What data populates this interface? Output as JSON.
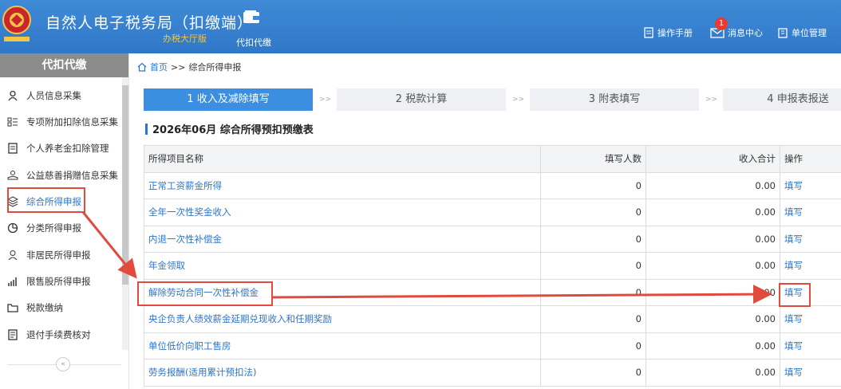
{
  "header": {
    "app_title": "自然人电子税务局（扣缴端）",
    "hall_label": "办税大厅版",
    "nav_tab": "代扣代缴",
    "links": {
      "manual": "操作手册",
      "messages": "消息中心",
      "unit_mgmt": "单位管理"
    },
    "message_count": "1",
    "colors": {
      "header_bg": "#2f78c8",
      "accent": "#2e74c8",
      "highlight": "#e04b3e"
    }
  },
  "sidebar": {
    "title": "代扣代缴",
    "items": [
      {
        "label": "人员信息采集",
        "icon": "person-icon"
      },
      {
        "label": "专项附加扣除信息采集",
        "icon": "list-icon"
      },
      {
        "label": "个人养老金扣除管理",
        "icon": "document-icon"
      },
      {
        "label": "公益慈善捐赠信息采集",
        "icon": "donate-hand-icon"
      },
      {
        "label": "综合所得申报",
        "icon": "layers-icon"
      },
      {
        "label": "分类所得申报",
        "icon": "pie-icon"
      },
      {
        "label": "非居民所得申报",
        "icon": "person-outline-icon"
      },
      {
        "label": "限售股所得申报",
        "icon": "bar-chart-icon"
      },
      {
        "label": "税款缴纳",
        "icon": "folder-icon"
      },
      {
        "label": "退付手续费核对",
        "icon": "check-doc-icon"
      }
    ],
    "collapse_glyph": "«"
  },
  "breadcrumb": {
    "home": "首页",
    "sep": ">>",
    "current": "综合所得申报"
  },
  "steps": [
    {
      "label": "1 收入及减除填写"
    },
    {
      "label": "2 税款计算"
    },
    {
      "label": "3 附表填写"
    },
    {
      "label": "4 申报表报送"
    }
  ],
  "step_sep": ">>",
  "table": {
    "title": "2026年06月  综合所得预扣预缴表",
    "headers": [
      "所得项目名称",
      "填写人数",
      "收入合计",
      "操作"
    ],
    "rows": [
      [
        "正常工资薪金所得",
        "0",
        "0.00",
        "填写"
      ],
      [
        "全年一次性奖金收入",
        "0",
        "0.00",
        "填写"
      ],
      [
        "内退一次性补偿金",
        "0",
        "0.00",
        "填写"
      ],
      [
        "年金领取",
        "0",
        "0.00",
        "填写"
      ],
      [
        "解除劳动合同一次性补偿金",
        "0",
        "0.00",
        "填写"
      ],
      [
        "央企负责人绩效薪金延期兑现收入和任期奖励",
        "0",
        "0.00",
        "填写"
      ],
      [
        "单位低价向职工售房",
        "0",
        "0.00",
        "填写"
      ],
      [
        "劳务报酬(适用累计预扣法)",
        "0",
        "0.00",
        "填写"
      ]
    ]
  }
}
